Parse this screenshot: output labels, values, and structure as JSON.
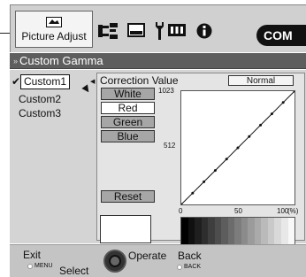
{
  "toolbar": {
    "active_label": "Picture Adjust",
    "icons": [
      "picture-adjust-icon",
      "connections-icon",
      "display-icon",
      "setup-wrench-icon",
      "function-icon",
      "information-icon"
    ]
  },
  "brand": "COM",
  "menu_title": "Custom Gamma",
  "list": {
    "items": [
      "Custom1",
      "Custom2",
      "Custom3"
    ],
    "selected": "Custom1"
  },
  "panel": {
    "heading": "Correction Value",
    "mode": "Normal",
    "buttons": {
      "white": "White",
      "red": "Red",
      "green": "Green",
      "blue": "Blue",
      "reset": "Reset"
    },
    "selected_button": "white"
  },
  "chart_data": {
    "type": "line",
    "series": [
      {
        "x": [
          0,
          10,
          20,
          30,
          40,
          50,
          60,
          70,
          80,
          90,
          100
        ],
        "y": [
          0,
          102.3,
          204.6,
          306.9,
          409.2,
          511.5,
          613.8,
          716.1,
          818.4,
          920.7,
          1023
        ]
      }
    ],
    "xticks": [
      "0",
      "50",
      "100"
    ],
    "xunit": "(%)",
    "yticks": [
      "1023",
      "512"
    ],
    "xlim": [
      0,
      100
    ],
    "ylim": [
      0,
      1023
    ],
    "grid": false
  },
  "gradient_steps": [
    "#000000",
    "#101010",
    "#1f1f1f",
    "#2e2e2e",
    "#3e3e3e",
    "#4d4d4d",
    "#5d5d5d",
    "#6c6c6c",
    "#7c7c7c",
    "#8b8b8b",
    "#9b9b9b",
    "#aaaaaa",
    "#bababa",
    "#c9c9c9",
    "#d9d9d9",
    "#e8e8e8",
    "#f8f8f8"
  ],
  "footer": {
    "exit": "Exit",
    "exit_key": "MENU",
    "select": "Select",
    "operate": "Operate",
    "back": "Back",
    "back_key": "BACK"
  }
}
